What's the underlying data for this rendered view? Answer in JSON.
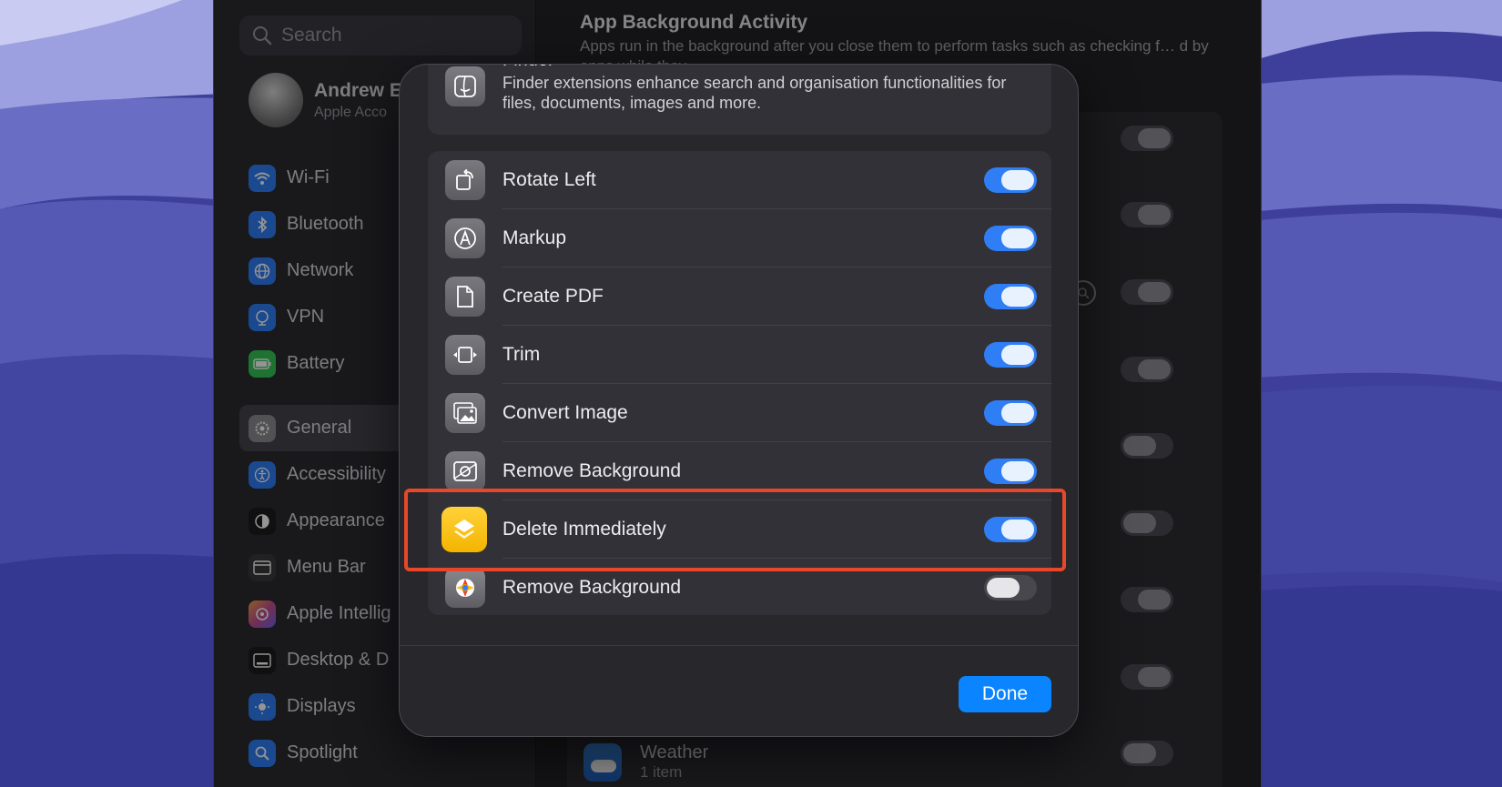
{
  "sidebar": {
    "search_placeholder": "Search",
    "profile": {
      "name": "Andrew E",
      "subtitle": "Apple Acco"
    },
    "items": [
      {
        "label": "Wi-Fi",
        "icon": "wifi-icon",
        "color": "#2f7ef6"
      },
      {
        "label": "Bluetooth",
        "icon": "bluetooth-icon",
        "color": "#2f7ef6"
      },
      {
        "label": "Network",
        "icon": "globe-icon",
        "color": "#2f7ef6"
      },
      {
        "label": "VPN",
        "icon": "vpn-globe-icon",
        "color": "#2f7ef6"
      },
      {
        "label": "Battery",
        "icon": "battery-icon",
        "color": "#34c759"
      },
      {
        "label": "General",
        "icon": "gear-icon",
        "color": "#8e8e93"
      },
      {
        "label": "Accessibility",
        "icon": "accessibility-icon",
        "color": "#2f7ef6"
      },
      {
        "label": "Appearance",
        "icon": "appearance-icon",
        "color": "#1c1c1e"
      },
      {
        "label": "Menu Bar",
        "icon": "menu-bar-icon",
        "color": "#3a3a3c"
      },
      {
        "label": "Apple Intellig",
        "icon": "apple-intelligence-icon",
        "color": "#c7508f"
      },
      {
        "label": "Desktop & D",
        "icon": "desktop-icon",
        "color": "#1c1c1e"
      },
      {
        "label": "Displays",
        "icon": "sun-icon",
        "color": "#2f7ef6"
      },
      {
        "label": "Spotlight",
        "icon": "spotlight-icon",
        "color": "#2f7ef6"
      }
    ]
  },
  "content": {
    "title": "App Background Activity",
    "description": "Apps run in the background after you close them to perform tasks such as checking f… d by apps while they",
    "weather": {
      "name": "Weather",
      "sub": "1 item"
    }
  },
  "sheet": {
    "finder": {
      "title": "Finder",
      "description": "Finder extensions enhance search and organisation functionalities for files, documents, images and more."
    },
    "extensions": [
      {
        "label": "Rotate Left",
        "icon": "rotate-left-icon",
        "enabled": true
      },
      {
        "label": "Markup",
        "icon": "markup-icon",
        "enabled": true
      },
      {
        "label": "Create PDF",
        "icon": "document-icon",
        "enabled": true
      },
      {
        "label": "Trim",
        "icon": "trim-icon",
        "enabled": true
      },
      {
        "label": "Convert Image",
        "icon": "photo-icon",
        "enabled": true
      },
      {
        "label": "Remove Background",
        "icon": "remove-background-icon",
        "enabled": true
      },
      {
        "label": "Delete Immediately",
        "icon": "shortcuts-icon",
        "enabled": true
      },
      {
        "label": "Remove Background",
        "icon": "pixelmator-icon",
        "enabled": false
      }
    ],
    "done_label": "Done"
  },
  "colors": {
    "accent": "#0a84ff",
    "highlight": "#e8472a",
    "shortcuts_yellow": "#f4b400"
  }
}
